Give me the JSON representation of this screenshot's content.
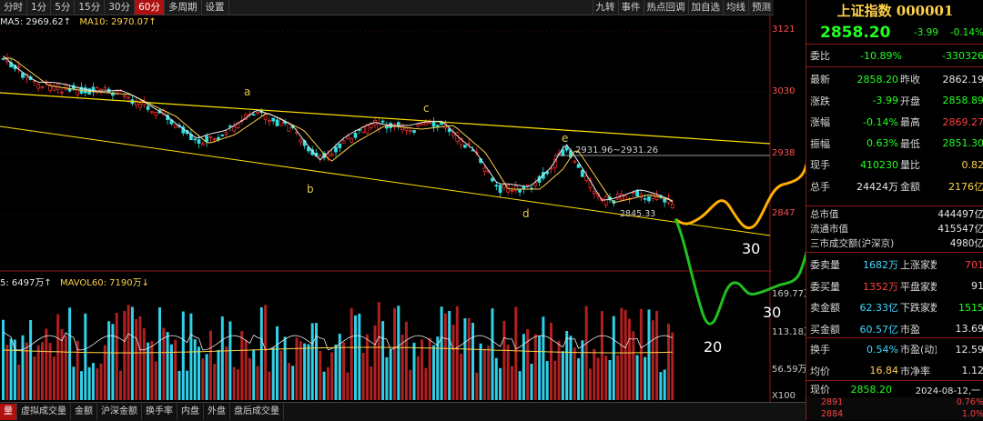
{
  "toolbar": {
    "periods": [
      {
        "label": "分时",
        "active": false
      },
      {
        "label": "1分",
        "active": false
      },
      {
        "label": "5分",
        "active": false
      },
      {
        "label": "15分",
        "active": false
      },
      {
        "label": "30分",
        "active": false
      },
      {
        "label": "60分",
        "active": true
      },
      {
        "label": "多周期",
        "active": false
      },
      {
        "label": "设置",
        "active": false
      }
    ],
    "tools": [
      "九转",
      "事件",
      "热点回调",
      "加自选",
      "均线",
      "预测"
    ]
  },
  "chart_legend": {
    "ma5": "MA5: 2969.62↑",
    "ma10": "MA10: 2970.07↑",
    "vol": "5: 6497万↑",
    "mavol60": "MAVOL60: 7190万↓"
  },
  "axis": {
    "price_ticks": [
      "3121",
      "3030",
      "2938",
      "2847"
    ],
    "volume_ticks": [
      "169.77万",
      "113.18万",
      "56.59万",
      "X100"
    ]
  },
  "annotations": {
    "wave_a": "a",
    "wave_b": "b",
    "wave_c": "c",
    "wave_d": "d",
    "wave_e": "e",
    "range_label": "2931.96~2931.26",
    "low_label": "2845.33",
    "target_yellow": "30",
    "target_green_low": "20",
    "target_green_end": "30"
  },
  "bottom_tabs": [
    {
      "label": "量",
      "active": true
    },
    {
      "label": "虚拟成交量",
      "active": false
    },
    {
      "label": "金额",
      "active": false
    },
    {
      "label": "沪深金额",
      "active": false
    },
    {
      "label": "换手率",
      "active": false
    },
    {
      "label": "内盘",
      "active": false
    },
    {
      "label": "外盘",
      "active": false
    },
    {
      "label": "盘后成交量",
      "active": false
    }
  ],
  "quote": {
    "title": "上证指数 000001",
    "price": "2858.20",
    "change": "-3.99",
    "pct": "-0.14%",
    "weibi_label": "委比",
    "weibi": "-10.89%",
    "weicha": "-330326",
    "rows": [
      {
        "l1": "最新",
        "v1": "2858.20",
        "c1": "green",
        "l2": "昨收",
        "v2": "2862.19",
        "c2": "white"
      },
      {
        "l1": "涨跌",
        "v1": "-3.99",
        "c1": "green",
        "l2": "开盘",
        "v2": "2858.89",
        "c2": "green"
      },
      {
        "l1": "涨幅",
        "v1": "-0.14%",
        "c1": "green",
        "l2": "最高",
        "v2": "2869.27",
        "c2": "red"
      },
      {
        "l1": "振幅",
        "v1": "0.63%",
        "c1": "green",
        "l2": "最低",
        "v2": "2851.30",
        "c2": "green"
      },
      {
        "l1": "现手",
        "v1": "410230",
        "c1": "green",
        "l2": "量比",
        "v2": "0.82",
        "c2": "yellow"
      },
      {
        "l1": "总手",
        "v1": "24424万",
        "c1": "white",
        "l2": "金额",
        "v2": "2176亿",
        "c2": "yellow"
      }
    ],
    "market": [
      {
        "label": "总市值",
        "value": "444497亿"
      },
      {
        "label": "流通市值",
        "value": "415547亿"
      },
      {
        "label": "三市成交额(沪深京)",
        "value": "4980亿"
      }
    ],
    "rows2": [
      {
        "l1": "委卖量",
        "v1": "1682万",
        "c1": "cyan",
        "l2": "上涨家数",
        "v2": "701",
        "c2": "red"
      },
      {
        "l1": "委买量",
        "v1": "1352万",
        "c1": "red",
        "l2": "平盘家数",
        "v2": "91",
        "c2": "white"
      },
      {
        "l1": "卖金额",
        "v1": "62.33亿",
        "c1": "cyan",
        "l2": "下跌家数",
        "v2": "1515",
        "c2": "green"
      },
      {
        "l1": "买金额",
        "v1": "60.57亿",
        "c1": "cyan",
        "l2": "市盈",
        "v2": "13.69",
        "c2": "white"
      }
    ],
    "rows3": [
      {
        "l1": "换手",
        "v1": "0.54%",
        "c1": "cyan",
        "l2": "市盈(动)",
        "v2": "12.59",
        "c2": "white"
      },
      {
        "l1": "均价",
        "v1": "16.84",
        "c1": "yellow",
        "l2": "市净率",
        "v2": "1.12",
        "c2": "white"
      }
    ],
    "last_row": {
      "label": "现价",
      "price": "2858.20",
      "time": "2024-08-12,一"
    },
    "mini_ticks": [
      "2891",
      "0.76%",
      "2884",
      "1.0%"
    ]
  }
}
